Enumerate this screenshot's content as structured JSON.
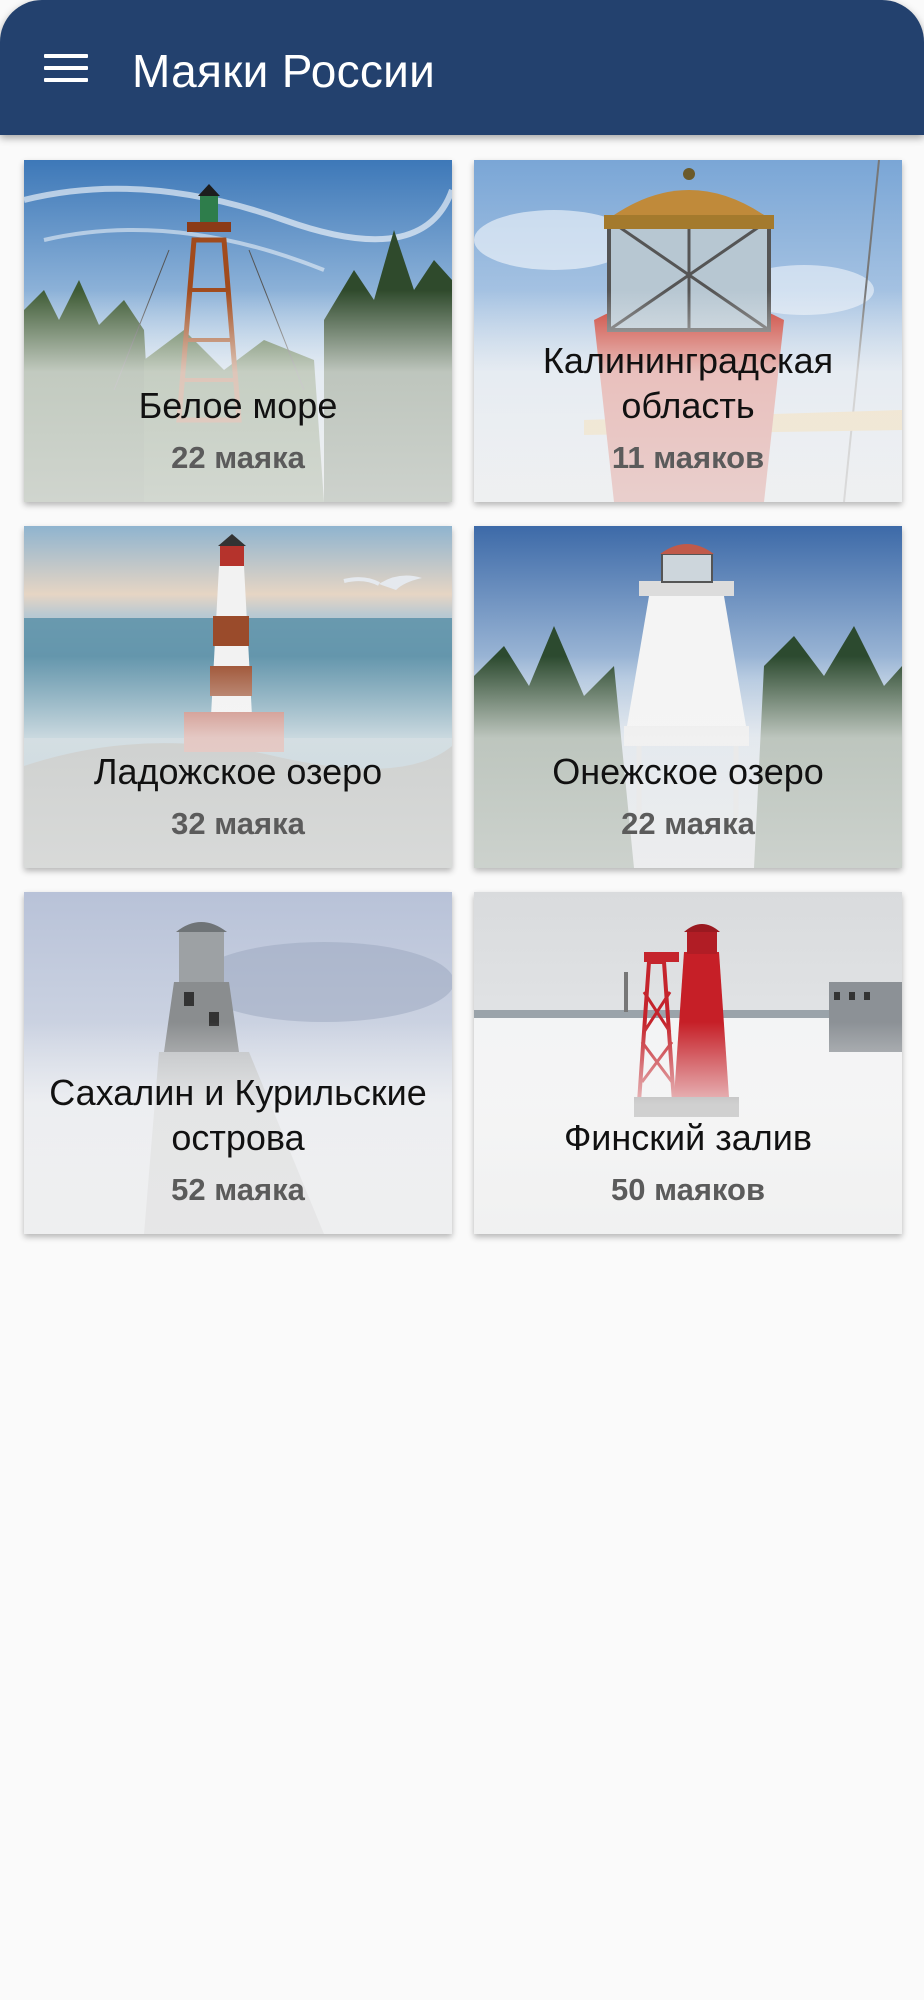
{
  "app_bar": {
    "title": "Маяки России",
    "menu_icon": "hamburger-menu-icon",
    "color": "#23416e"
  },
  "regions": [
    {
      "name": "Белое море",
      "count": "22 маяка"
    },
    {
      "name": "Калининградская область",
      "count": "11 маяков"
    },
    {
      "name": "Ладожское озеро",
      "count": "32 маяка"
    },
    {
      "name": "Онежское озеро",
      "count": "22 маяка"
    },
    {
      "name": "Сахалин и Курильские острова",
      "count": "52 маяка"
    },
    {
      "name": "Финский залив",
      "count": "50 маяков"
    }
  ]
}
